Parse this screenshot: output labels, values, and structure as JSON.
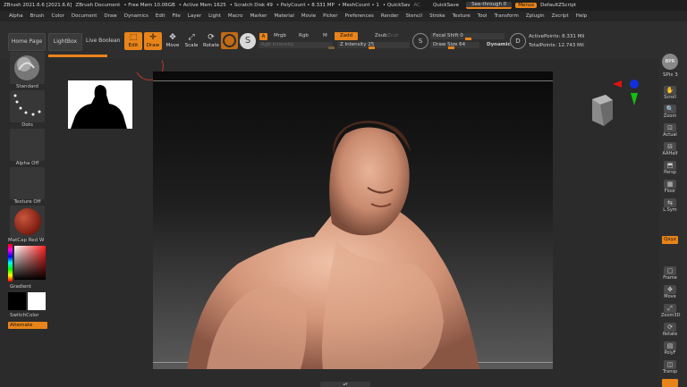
{
  "titlebar": {
    "app": "ZBrush 2021.6.6 [2021.6.6]",
    "doc": "ZBrush Document",
    "free_mem": "• Free Mem 10.06GB",
    "active_mem": "• Active Mem 1625",
    "scratch": "• Scratch Disk 49",
    "polycount": "• PolyCount • 8.331 MP",
    "meshcount": "• MeshCount • 1",
    "quicksav": "• QuickSav",
    "ac": "AC",
    "quicksave": "QuickSave",
    "see_through": "See-through  0",
    "menus": "Menus",
    "default_script": "DefaultZScript"
  },
  "menubar": [
    "Alpha",
    "Brush",
    "Color",
    "Document",
    "Draw",
    "Dynamics",
    "Edit",
    "File",
    "Layer",
    "Light",
    "Macro",
    "Marker",
    "Material",
    "Movie",
    "Picker",
    "Preferences",
    "Render",
    "Stencil",
    "Stroke",
    "Texture",
    "Tool",
    "Transform",
    "Zplugin",
    "Zscript",
    "Help"
  ],
  "shelf": {
    "home_page": "Home Page",
    "lightbox": "LightBox",
    "live_boolean": "Live Boolean",
    "edit": "Edit",
    "draw": "Draw",
    "move": "Move",
    "scale": "Scale",
    "rotate": "Rotate",
    "a": "A",
    "mrgb": "Mrgb",
    "rgb": "Rgb",
    "m": "M",
    "zadd": "Zadd",
    "zsub": "Zsub",
    "zcut": "Zcut",
    "rgb_intensity": "Rgb Intensity",
    "z_intensity": "Z Intensity 25",
    "s": "S",
    "focal_shift": "Focal Shift 0",
    "draw_size": "Draw Size 64",
    "dynamic": "Dynamic",
    "d": "D",
    "active_points": "ActivePoints: 8.331 Mil",
    "total_points": "TotalPoints: 12.743 Mil"
  },
  "left": {
    "standard": "Standard",
    "dots": "Dots",
    "alpha_off": "Alpha Off",
    "texture_off": "Texture Off",
    "matcap": "MatCap Red W",
    "gradient": "Gradient",
    "switch_color": "SwitchColor",
    "alternate": "Alternate"
  },
  "right": {
    "bpr": "BPR",
    "spix": "SPix 3",
    "scroll": "Scroll",
    "zoom": "Zoom",
    "actual": "Actual",
    "aahalf": "AAHalf",
    "persp": "Persp",
    "floor": "Floor",
    "lsym": "L.Sym",
    "qxyz": "Qxyz",
    "frame": "Frame",
    "move": "Move",
    "zoom3d": "Zoom3D",
    "rotate": "Rotate",
    "polyf": "PolyF",
    "transp": "Transp"
  },
  "colors": {
    "accent": "#e8841a",
    "bg": "#2b2b2b",
    "panel": "#373737"
  }
}
